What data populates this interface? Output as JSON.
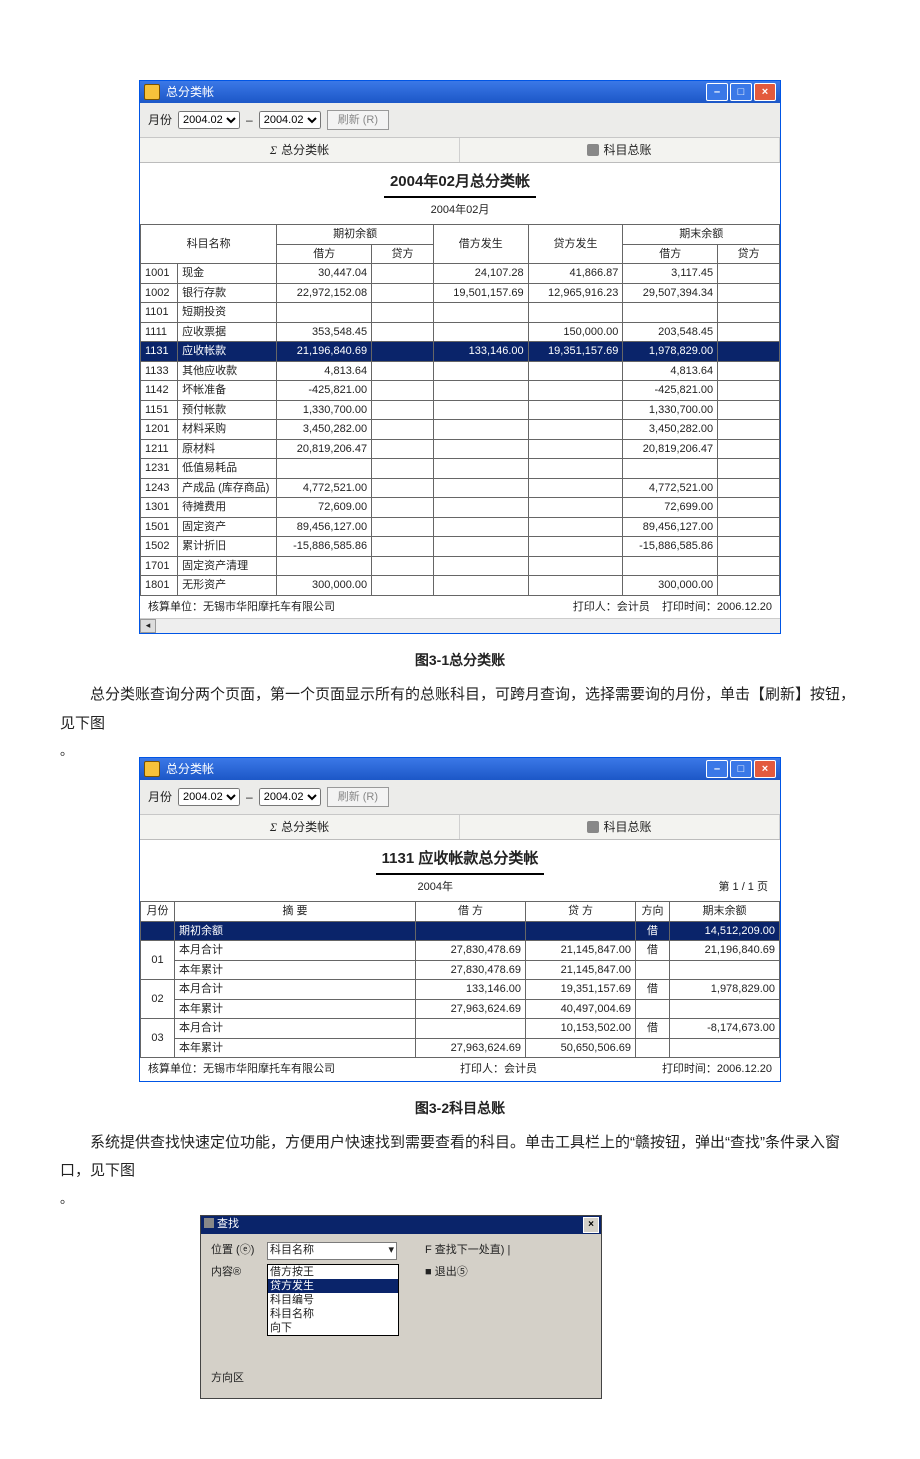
{
  "fig1": {
    "win_title": "总分类帐",
    "toolbar": {
      "label_month": "月份",
      "from": "2004.02",
      "to": "2004.02",
      "btn_refresh": "刷新 (R)"
    },
    "tabs": {
      "left_prefix": "Σ",
      "left": "总分类帐",
      "right_icon": "grid",
      "right": "科目总账"
    },
    "title": "2004年02月总分类帐",
    "subtitle": "2004年02月",
    "headers": {
      "code": "科目名称",
      "debit0_group": "期初余额",
      "debit0": "借方",
      "credit0": "贷方",
      "debit_occur": "借方发生",
      "credit_occur": "贷方发生",
      "end_group": "期末余额",
      "debit_end": "借方",
      "credit_end": "贷方"
    },
    "rows": [
      {
        "c": "1001",
        "n": "现金",
        "d0": "30,447.04",
        "ddo": "24,107.28",
        "dco": "41,866.87",
        "de": "3,117.45"
      },
      {
        "c": "1002",
        "n": "银行存款",
        "d0": "22,972,152.08",
        "ddo": "19,501,157.69",
        "dco": "12,965,916.23",
        "de": "29,507,394.34"
      },
      {
        "c": "1101",
        "n": "短期投资"
      },
      {
        "c": "1111",
        "n": "应收票据",
        "d0": "353,548.45",
        "dco": "150,000.00",
        "de": "203,548.45"
      },
      {
        "c": "1131",
        "n": "应收帐款",
        "d0": "21,196,840.69",
        "ddo": "133,146.00",
        "dco": "19,351,157.69",
        "de": "1,978,829.00",
        "sel": true
      },
      {
        "c": "1133",
        "n": "其他应收款",
        "d0": "4,813.64",
        "de": "4,813.64"
      },
      {
        "c": "1142",
        "n": "坏帐准备",
        "d0": "-425,821.00",
        "de": "-425,821.00"
      },
      {
        "c": "1151",
        "n": "预付帐款",
        "d0": "1,330,700.00",
        "de": "1,330,700.00"
      },
      {
        "c": "1201",
        "n": "材料采购",
        "d0": "3,450,282.00",
        "de": "3,450,282.00"
      },
      {
        "c": "1211",
        "n": "原材料",
        "d0": "20,819,206.47",
        "de": "20,819,206.47"
      },
      {
        "c": "1231",
        "n": "低值易耗品"
      },
      {
        "c": "1243",
        "n": "产成品 (库存商品)",
        "d0": "4,772,521.00",
        "de": "4,772,521.00"
      },
      {
        "c": "1301",
        "n": "待摊费用",
        "d0": "72,609.00",
        "de": "72,699.00"
      },
      {
        "c": "1501",
        "n": "固定资产",
        "d0": "89,456,127.00",
        "de": "89,456,127.00"
      },
      {
        "c": "1502",
        "n": "累计折旧",
        "d0": "-15,886,585.86",
        "de": "-15,886,585.86"
      },
      {
        "c": "1701",
        "n": "固定资产清理"
      },
      {
        "c": "1801",
        "n": "无形资产",
        "d0": "300,000.00",
        "de": "300,000.00"
      }
    ],
    "footer": {
      "unit": "核算单位：无锡市华阳摩托车有限公司",
      "printer": "打印人：会计员",
      "time": "打印时间：2006.12.20"
    },
    "caption": "图3-1总分类账"
  },
  "p1": "总分类账查询分两个页面，第一个页面显示所有的总账科目，可跨月查询，选择需要询的月份，单击【刷新】按钮，见下图",
  "fig2": {
    "win_title": "总分类帐",
    "toolbar": {
      "label_month": "月份",
      "from": "2004.02",
      "to": "2004.02",
      "btn_refresh": "刷新 (R)"
    },
    "tabs": {
      "left_prefix": "Σ",
      "left": "总分类帐",
      "right": "科目总账"
    },
    "title": "1131  应收帐款总分类帐",
    "subtitle": "2004年",
    "page": "第 1 / 1 页",
    "headers": {
      "m": "月份",
      "s": "摘  要",
      "d": "借  方",
      "c": "贷  方",
      "dir": "方向",
      "e": "期末余额"
    },
    "rows": [
      {
        "m": "",
        "s": "期初余额",
        "d": "",
        "c": "",
        "dir": "借",
        "e": "14,512,209.00",
        "sel": true
      },
      {
        "m": "01",
        "s": "本月合计",
        "d": "27,830,478.69",
        "c": "21,145,847.00",
        "dir": "借",
        "e": "21,196,840.69"
      },
      {
        "m": "01b",
        "s": "本年累计",
        "d": "27,830,478.69",
        "c": "21,145,847.00"
      },
      {
        "m": "02",
        "s": "本月合计",
        "d": "133,146.00",
        "c": "19,351,157.69",
        "dir": "借",
        "e": "1,978,829.00"
      },
      {
        "m": "02b",
        "s": "本年累计",
        "d": "27,963,624.69",
        "c": "40,497,004.69"
      },
      {
        "m": "03",
        "s": "本月合计",
        "d": "",
        "c": "10,153,502.00",
        "dir": "借",
        "e": "-8,174,673.00"
      },
      {
        "m": "03b",
        "s": "本年累计",
        "d": "27,963,624.69",
        "c": "50,650,506.69"
      }
    ],
    "footer": {
      "unit": "核算单位：无锡市华阳摩托车有限公司",
      "printer": "打印人：会计员",
      "time": "打印时间：2006.12.20"
    },
    "caption": "图3-2科目总账"
  },
  "p2": "系统提供查找快速定位功能，方便用户快速找到需要查看的科目。单击工具栏上的“赣按钮，弹出“查找”条件录入窗口，见下图",
  "dialog": {
    "title": "查找",
    "pos_label": "位置 (ⓔ)",
    "pos_value": "科目名称",
    "content_label": "内容®",
    "options": [
      "借方按王",
      "贷方发生",
      "科目编号",
      "科目名称",
      "向下"
    ],
    "opt_selected": 1,
    "dir_label": "方向区",
    "find_next": "F  查找下一处直)  |",
    "exit": "退出⑤"
  }
}
